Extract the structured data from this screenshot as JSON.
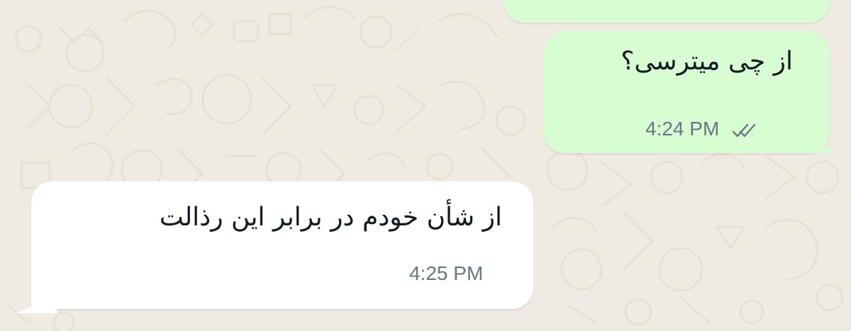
{
  "messages": [
    {
      "direction": "outgoing",
      "text": "از چی میترسی؟",
      "time": "4:24 PM",
      "status_icon": "double-check-icon"
    },
    {
      "direction": "incoming",
      "text": "از شأن خودم در برابر این رذالت",
      "time": "4:25 PM"
    }
  ],
  "colors": {
    "background": "#efeae2",
    "outgoing_bubble": "#d9fdd3",
    "incoming_bubble": "#ffffff",
    "meta_text": "#667781"
  }
}
